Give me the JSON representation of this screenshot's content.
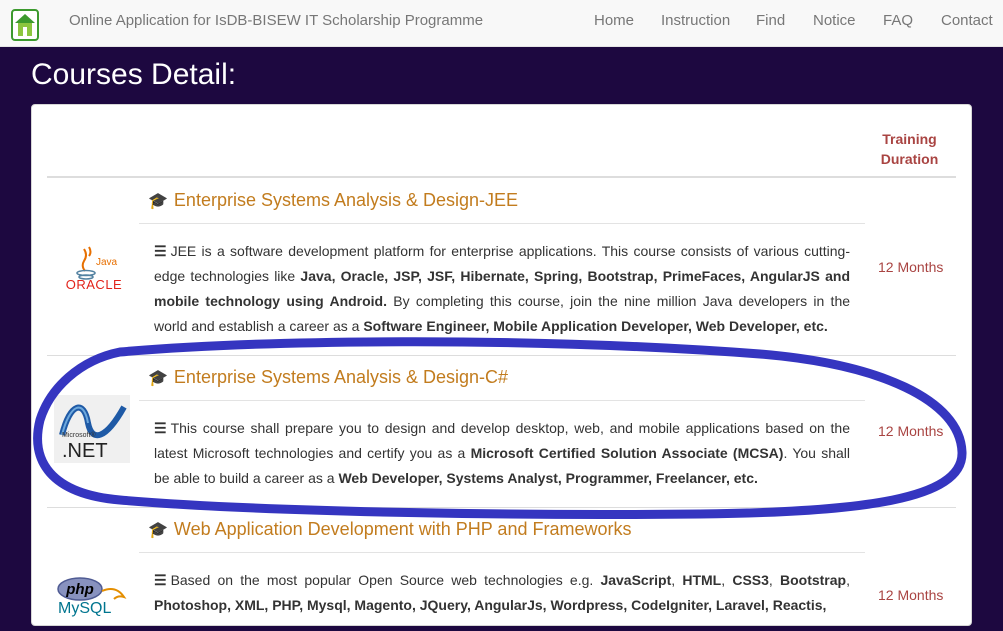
{
  "header": {
    "brand_text": "Online Application for IsDB-BISEW IT Scholarship Programme",
    "nav": [
      "Home",
      "Instruction",
      "Find",
      "Notice",
      "FAQ",
      "Contact"
    ]
  },
  "page_title": "Courses Detail:",
  "table": {
    "duration_header_line1": "Training",
    "duration_header_line2": "Duration"
  },
  "courses": [
    {
      "title": "Enterprise Systems Analysis & Design-JEE",
      "logo": "oracle-java-logo",
      "logo_text": "ORACLE",
      "logo_subtext": "Java",
      "description_parts": [
        "JEE is a software development platform for enterprise applications. This course consists of various cutting-edge technologies like ",
        "Java, Oracle, JSP, JSF, Hibernate, Spring, Bootstrap, PrimeFaces, AngularJS and mobile technology using Android.",
        " By completing this course, join the nine million Java developers in the world and establish a career as a ",
        "Software Engineer, Mobile Application Developer, Web Developer, etc."
      ],
      "duration": "12 Months"
    },
    {
      "title": "Enterprise Systems Analysis & Design-C#",
      "logo": "microsoft-dotnet-logo",
      "logo_text": ".NET",
      "logo_subtext": "Microsoft®",
      "description_parts": [
        "This course shall prepare you to design and develop desktop, web, and mobile applications based on the latest Microsoft technologies and certify you as a ",
        "Microsoft Certified Solution Associate (MCSA)",
        ". You shall be able to build a career as a ",
        "Web Developer, Systems Analyst, Programmer, Freelancer, etc."
      ],
      "duration": "12 Months"
    },
    {
      "title": "Web Application Development with PHP and Frameworks",
      "logo": "php-mysql-logo",
      "logo_text": "MySQL",
      "logo_subtext": "php",
      "description_parts": [
        "Based on the most popular Open Source web technologies e.g. ",
        "JavaScript",
        ", ",
        "HTML",
        ", ",
        "CSS3",
        ", ",
        "Bootstrap",
        ", ",
        "Photoshop, XML, PHP, Mysql, Magento, JQuery, AngularJs, Wordpress, CodeIgniter, Laravel, Reactis,"
      ],
      "duration": "12 Months"
    }
  ],
  "colors": {
    "background": "#1d0840",
    "course_title": "#c27c1e",
    "duration": "#a94442",
    "annotation_stroke": "#3535c0"
  },
  "icons": {
    "course_title_icon": "graduation-cap-icon",
    "description_icon": "bars-icon"
  }
}
